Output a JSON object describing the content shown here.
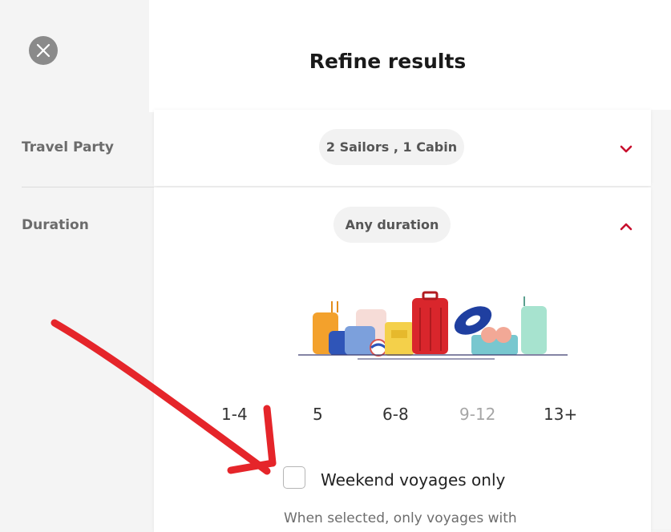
{
  "modal": {
    "title": "Refine results"
  },
  "filters": {
    "travel_party": {
      "label": "Travel Party",
      "value": "2 Sailors , 1 Cabin"
    },
    "duration": {
      "label": "Duration",
      "value": "Any duration"
    }
  },
  "duration_options": [
    {
      "label": "1-4",
      "enabled": true
    },
    {
      "label": "5",
      "enabled": true
    },
    {
      "label": "6-8",
      "enabled": true
    },
    {
      "label": "9-12",
      "enabled": false
    },
    {
      "label": "13+",
      "enabled": true
    }
  ],
  "weekend": {
    "label": "Weekend voyages only",
    "checked": false,
    "helper": "When selected, only voyages with"
  },
  "icons": {
    "close": "close-icon",
    "travel_chevron": "chevron-down-icon",
    "duration_chevron": "chevron-up-icon"
  },
  "colors": {
    "accent_red": "#c8102e",
    "annotation_red": "#e5252a",
    "top_line": "#3c8a7f"
  }
}
